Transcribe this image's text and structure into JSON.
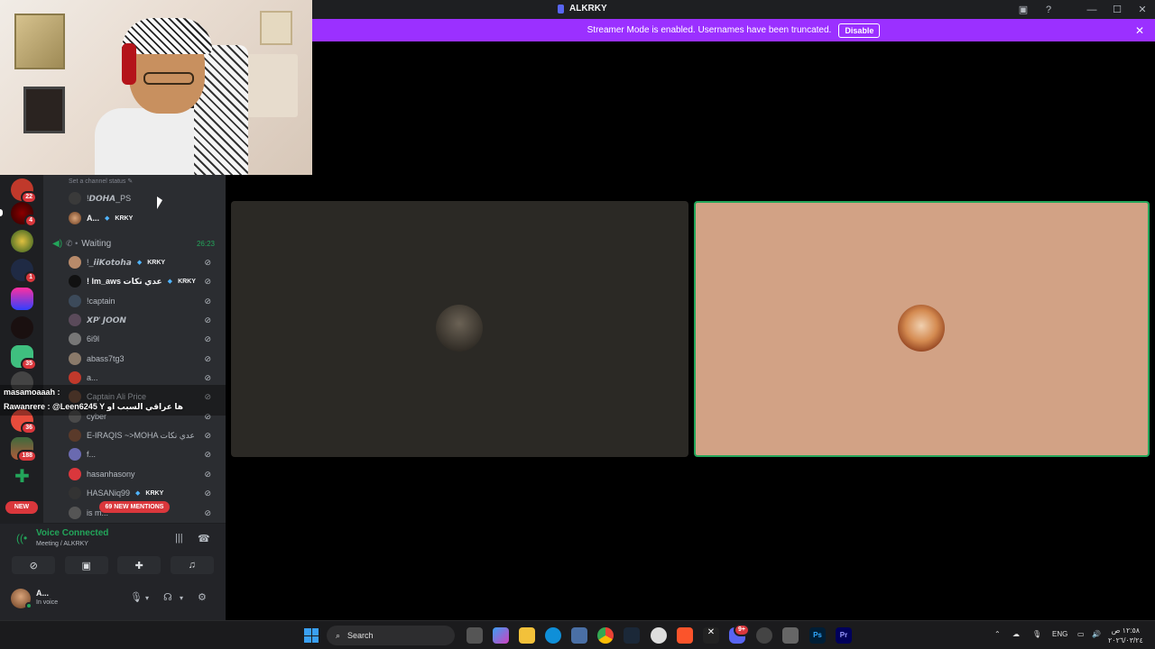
{
  "window": {
    "title": "ALKRKY"
  },
  "banner": {
    "text": "Streamer Mode is enabled. Usernames have been truncated.",
    "button": "Disable"
  },
  "server_rail": {
    "badges": [
      "22",
      "4",
      "1",
      "35",
      "36",
      "188"
    ],
    "new_label": "NEW"
  },
  "channel": {
    "status_hint": "Set a channel status ✎",
    "top_users": [
      {
        "name": "!𝘿𝙊𝙃𝘼_PS",
        "tag": ""
      },
      {
        "name": "A...",
        "tag": "KRKY"
      }
    ],
    "voice_channel": {
      "name": "Waiting",
      "time": "26:23"
    },
    "users": [
      {
        "name": "!_𝙞𝙞𝙆𝙤𝙩𝙤𝙝𝙖",
        "tag": "KRKY"
      },
      {
        "name": "! lm_aws عدي نكات",
        "tag": "KRKY"
      },
      {
        "name": "!captain",
        "tag": ""
      },
      {
        "name": "𝙓𝙋' 𝙅𝙊𝙊𝙉",
        "tag": ""
      },
      {
        "name": "6i9l",
        "tag": ""
      },
      {
        "name": "abass7tg3",
        "tag": ""
      },
      {
        "name": "a...",
        "tag": ""
      },
      {
        "name": "Captain Ali Price",
        "tag": ""
      },
      {
        "name": "cyber",
        "tag": ""
      },
      {
        "name": "E-IRAQIS ~>MOHA عدي نكات",
        "tag": ""
      },
      {
        "name": "f...",
        "tag": ""
      },
      {
        "name": "hasanhasony",
        "tag": ""
      },
      {
        "name": "HASANiq99",
        "tag": "KRKY"
      },
      {
        "name": "is m...",
        "tag": ""
      }
    ],
    "mentions": "69 NEW MENTIONS"
  },
  "chat_overlay": {
    "line1": "masamoaaah :",
    "line2": "Rawanrere : @Leen6245 Y ها عراقي السبب او"
  },
  "voice_panel": {
    "title": "Voice Connected",
    "subtitle": "Meeting / ALKRKY"
  },
  "user_panel": {
    "name": "A...",
    "status": "In voice"
  },
  "taskbar": {
    "search": "Search",
    "lang": "ENG",
    "time": "١٢:٥٨ ص",
    "date": "٢٠٢٦/٠٣/٢٤",
    "discord_badge": "9+"
  }
}
